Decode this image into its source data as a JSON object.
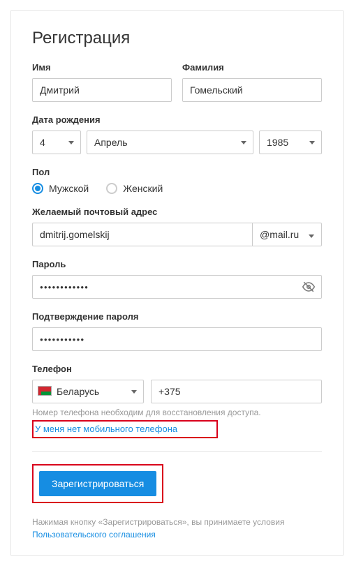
{
  "title": "Регистрация",
  "fields": {
    "first_name": {
      "label": "Имя",
      "value": "Дмитрий"
    },
    "last_name": {
      "label": "Фамилия",
      "value": "Гомельский"
    },
    "dob": {
      "label": "Дата рождения",
      "day": "4",
      "month": "Апрель",
      "year": "1985"
    },
    "gender": {
      "label": "Пол",
      "male": "Мужской",
      "female": "Женский",
      "selected": "male"
    },
    "email": {
      "label": "Желаемый почтовый адрес",
      "value": "dmitrij.gomelskij",
      "domain": "@mail.ru"
    },
    "password": {
      "label": "Пароль",
      "value": "●●●●●●●●●●●●"
    },
    "password_confirm": {
      "label": "Подтверждение пароля",
      "value": "●●●●●●●●●●●"
    },
    "phone": {
      "label": "Телефон",
      "country": "Беларусь",
      "code": "+375",
      "hint": "Номер телефона необходим для восстановления доступа."
    }
  },
  "links": {
    "no_phone": "У меня нет мобильного телефона",
    "terms": "Пользовательского соглашения"
  },
  "submit": "Зарегистрироваться",
  "terms_prefix": "Нажимая кнопку «Зарегистрироваться», вы принимаете условия "
}
